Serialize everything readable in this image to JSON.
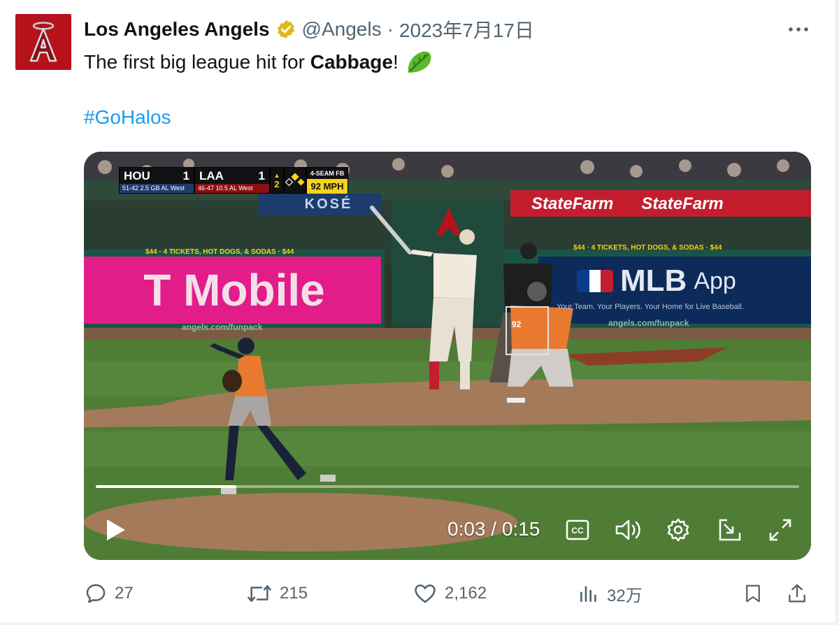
{
  "tweet": {
    "display_name": "Los Angeles Angels",
    "handle": "@Angels",
    "separator": "·",
    "date": "2023年7月17日",
    "text_prefix": "The first big league hit for ",
    "text_bold": "Cabbage",
    "text_suffix": "!",
    "hashtag": "#GoHalos"
  },
  "video": {
    "current_time": "0:03",
    "time_separator": " / ",
    "duration": "0:15",
    "progress_fraction": 0.2,
    "scorebug": {
      "away_team": "HOU",
      "away_score": "1",
      "away_record": "51-42 2.5 GB AL West",
      "home_team": "LAA",
      "home_score": "1",
      "home_record": "46-47 10.5 AL West",
      "inning": "2",
      "pitch_type": "4-SEAM FB",
      "pitch_speed": "92 MPH"
    },
    "ads": {
      "tmobile": "T Mobile",
      "mlb": "MLB",
      "mlb_app": "App",
      "mlb_tagline": "Your Team. Your Players. Your Home for Live Baseball.",
      "statefarm": "StateFarm",
      "kose": "KOSÉ",
      "tickets": "$44 · 4 TICKETS, HOT DOGS, & SODAS · $44",
      "funpack": "angels.com/funpack",
      "catcher_number": "92"
    }
  },
  "actions": {
    "replies": "27",
    "reposts": "215",
    "likes": "2,162",
    "views": "32万"
  },
  "icons": [
    "angels-logo-icon",
    "verified-badge-icon",
    "more-icon",
    "lettuce-emoji-icon",
    "play-icon",
    "captions-icon",
    "volume-icon",
    "settings-icon",
    "pip-icon",
    "fullscreen-icon",
    "reply-icon",
    "repost-icon",
    "like-icon",
    "views-icon",
    "bookmark-icon",
    "share-icon"
  ],
  "colors": {
    "angels_red": "#b5121b",
    "verified_gold": "#e2b719",
    "hashtag_blue": "#1d9bf0",
    "secondary_text": "#536471"
  }
}
